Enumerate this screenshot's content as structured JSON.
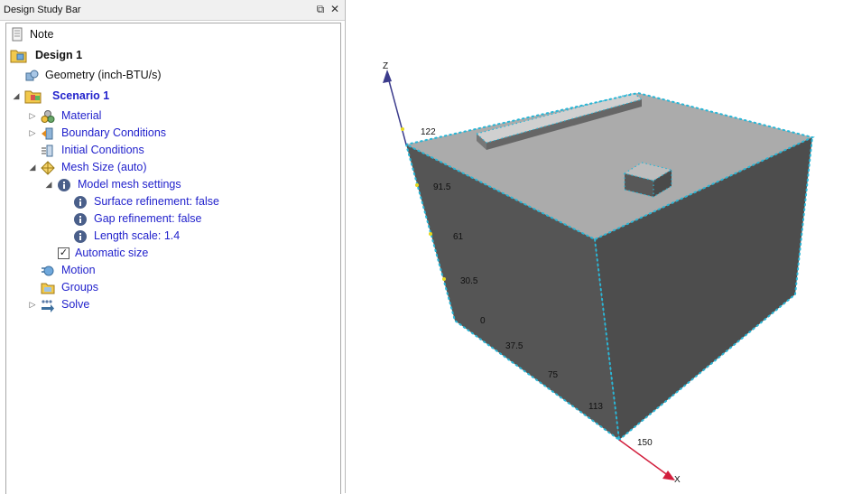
{
  "panel": {
    "title": "Design Study Bar"
  },
  "tree": {
    "note": "Note",
    "design": "Design 1",
    "geometry": "Geometry (inch-BTU/s)",
    "scenario": "Scenario 1",
    "material": "Material",
    "boundary_conditions": "Boundary Conditions",
    "initial_conditions": "Initial Conditions",
    "mesh_size": "Mesh Size (auto)",
    "model_mesh_settings": "Model mesh settings",
    "surface_refinement": "Surface refinement: false",
    "gap_refinement": "Gap refinement: false",
    "length_scale": "Length scale: 1.4",
    "automatic_size": "Automatic size",
    "automatic_size_checked": true,
    "motion": "Motion",
    "groups": "Groups",
    "solve": "Solve"
  },
  "viewport": {
    "axis_z": "Z",
    "axis_x": "X",
    "z_ticks": [
      "122",
      "91.5",
      "61",
      "30.5",
      "0"
    ],
    "x_ticks": [
      "37.5",
      "75",
      "113",
      "150"
    ],
    "colors": {
      "front_face": "#545454",
      "top_face": "#ababab",
      "edge_dots": "#29b6d6",
      "z_axis": "#3c3c8c",
      "x_axis": "#d21e3c",
      "tick_marker": "#e6d81e"
    }
  }
}
